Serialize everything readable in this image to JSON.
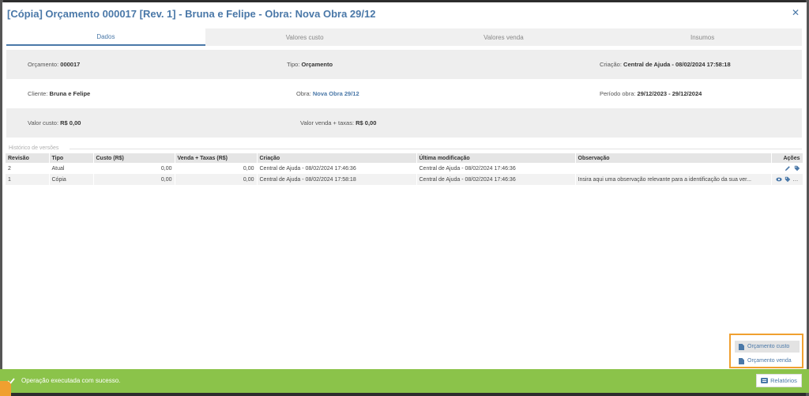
{
  "modal": {
    "title": "[Cópia] Orçamento 000017 [Rev. 1] - Bruna e Felipe - Obra: Nova Obra 29/12",
    "close_glyph": "✕"
  },
  "tabs": [
    {
      "label": "Dados",
      "active": true
    },
    {
      "label": "Valores custo",
      "active": false
    },
    {
      "label": "Valores venda",
      "active": false
    },
    {
      "label": "Insumos",
      "active": false
    }
  ],
  "info": {
    "orcamento_label": "Orçamento:",
    "orcamento_value": "000017",
    "tipo_label": "Tipo:",
    "tipo_value": "Orçamento",
    "criacao_label": "Criação:",
    "criacao_value": "Central de Ajuda - 08/02/2024 17:58:18",
    "cliente_label": "Cliente:",
    "cliente_value": "Bruna e Felipe",
    "obra_label": "Obra:",
    "obra_value": "Nova Obra 29/12",
    "periodo_label": "Período obra:",
    "periodo_value": "29/12/2023 - 29/12/2024",
    "valor_custo_label": "Valor custo:",
    "valor_custo_value": "R$ 0,00",
    "valor_venda_label": "Valor venda + taxas:",
    "valor_venda_value": "R$ 0,00"
  },
  "history": {
    "label": "Histórico de versões",
    "columns": [
      "Revisão",
      "Tipo",
      "Custo (R$)",
      "Venda + Taxas (R$)",
      "Criação",
      "Última modificação",
      "Observação",
      "Ações"
    ],
    "rows": [
      {
        "revisao": "2",
        "tipo": "Atual",
        "custo": "0,00",
        "venda": "0,00",
        "criacao": "Central de Ajuda - 08/02/2024 17:46:36",
        "modificacao": "Central de Ajuda - 08/02/2024 17:46:36",
        "observacao": ""
      },
      {
        "revisao": "1",
        "tipo": "Cópia",
        "custo": "0,00",
        "venda": "0,00",
        "criacao": "Central de Ajuda - 08/02/2024 17:58:18",
        "modificacao": "Central de Ajuda - 08/02/2024 17:46:36",
        "observacao": "Insira aqui uma observação relevante para a identificação da sua ver..."
      }
    ]
  },
  "reports_menu": {
    "items": [
      "Orçamento custo",
      "Orçamento venda"
    ]
  },
  "toast": {
    "message": "Operação executada com sucesso."
  },
  "reports_button": {
    "label": "Relatórios"
  },
  "colors": {
    "accent": "#4a78a8",
    "success": "#8bc34a",
    "highlight": "#f0a030"
  }
}
